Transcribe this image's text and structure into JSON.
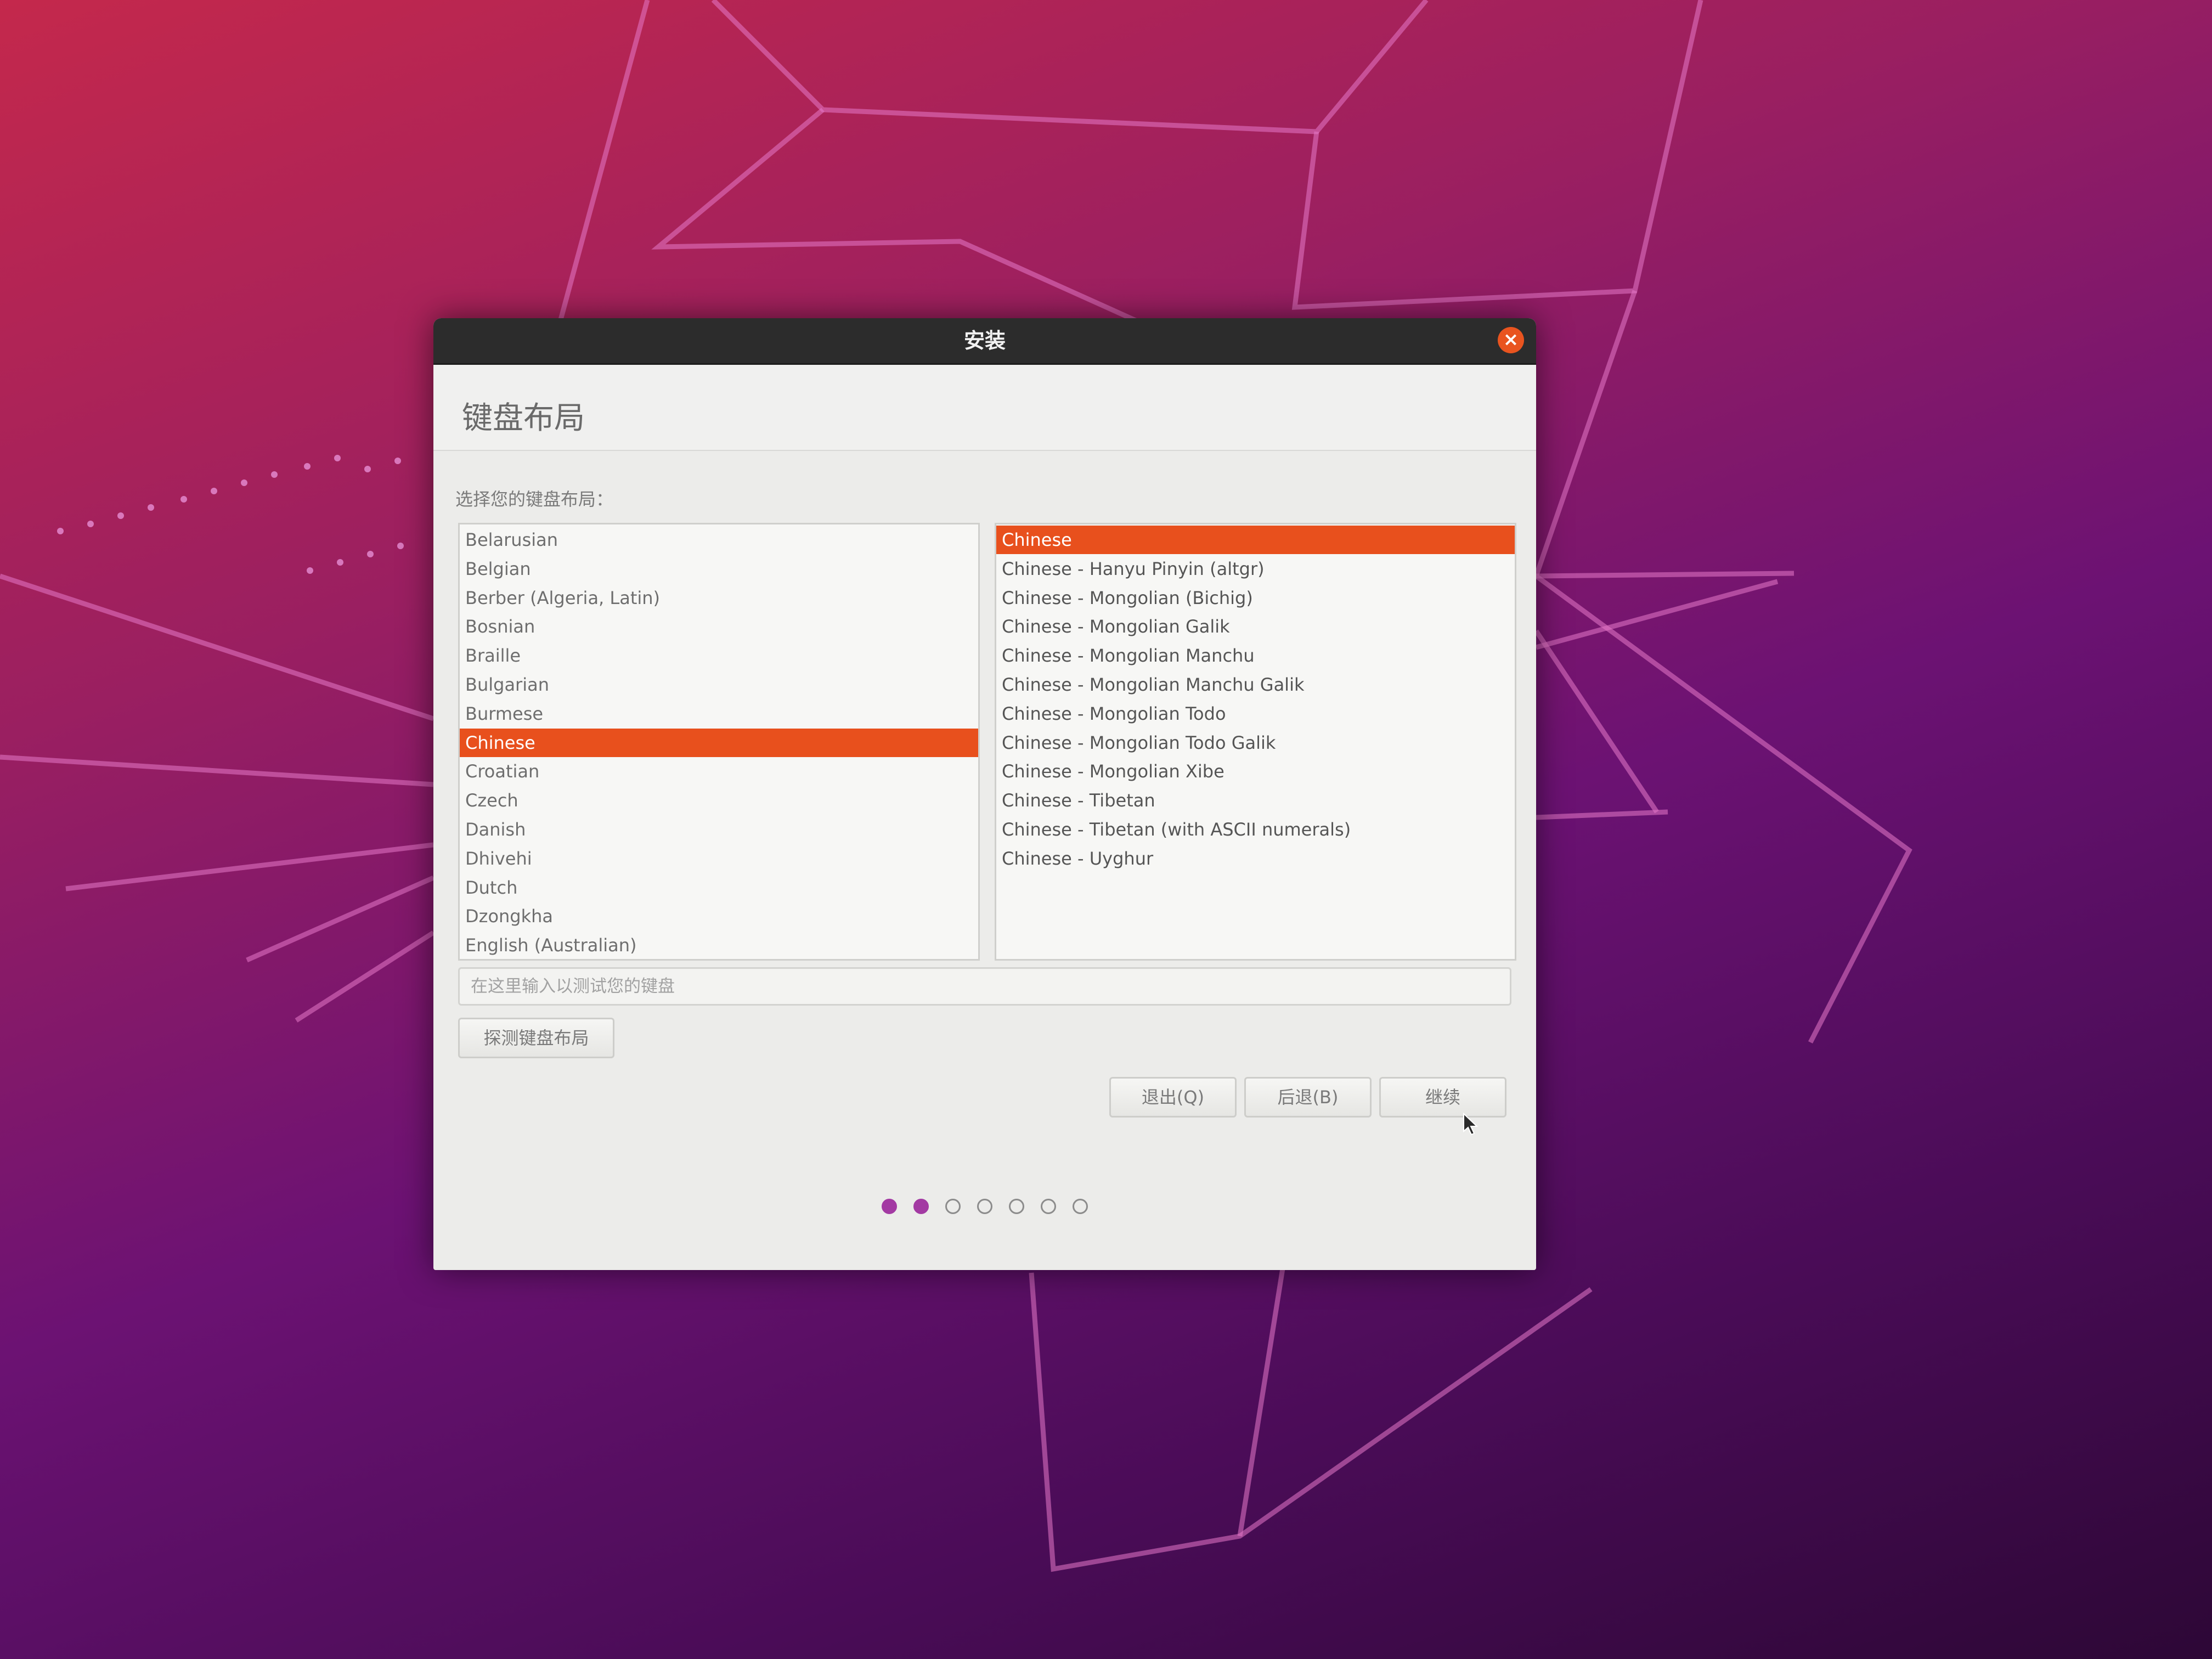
{
  "window": {
    "title": "安装",
    "close_label": "×"
  },
  "page": {
    "title": "键盘布局",
    "prompt": "选择您的键盘布局："
  },
  "layout_list": {
    "items": [
      "Belarusian",
      "Belgian",
      "Berber (Algeria, Latin)",
      "Bosnian",
      "Braille",
      "Bulgarian",
      "Burmese",
      "Chinese",
      "Croatian",
      "Czech",
      "Danish",
      "Dhivehi",
      "Dutch",
      "Dzongkha",
      "English (Australian)"
    ],
    "selected": "Chinese"
  },
  "variant_list": {
    "items": [
      "Chinese",
      "Chinese - Hanyu Pinyin (altgr)",
      "Chinese - Mongolian (Bichig)",
      "Chinese - Mongolian Galik",
      "Chinese - Mongolian Manchu",
      "Chinese - Mongolian Manchu Galik",
      "Chinese - Mongolian Todo",
      "Chinese - Mongolian Todo Galik",
      "Chinese - Mongolian Xibe",
      "Chinese - Tibetan",
      "Chinese - Tibetan (with ASCII numerals)",
      "Chinese - Uyghur"
    ],
    "selected": "Chinese"
  },
  "test_input": {
    "placeholder": "在这里输入以测试您的键盘",
    "value": ""
  },
  "buttons": {
    "detect": "探测键盘布局",
    "quit": "退出(Q)",
    "back": "后退(B)",
    "continue": "继续"
  },
  "progress": {
    "total_steps": 7,
    "completed_steps": 2
  },
  "colors": {
    "selection": "#e8501d",
    "close_button": "#e9541f",
    "progress_done": "#a33aa3"
  }
}
